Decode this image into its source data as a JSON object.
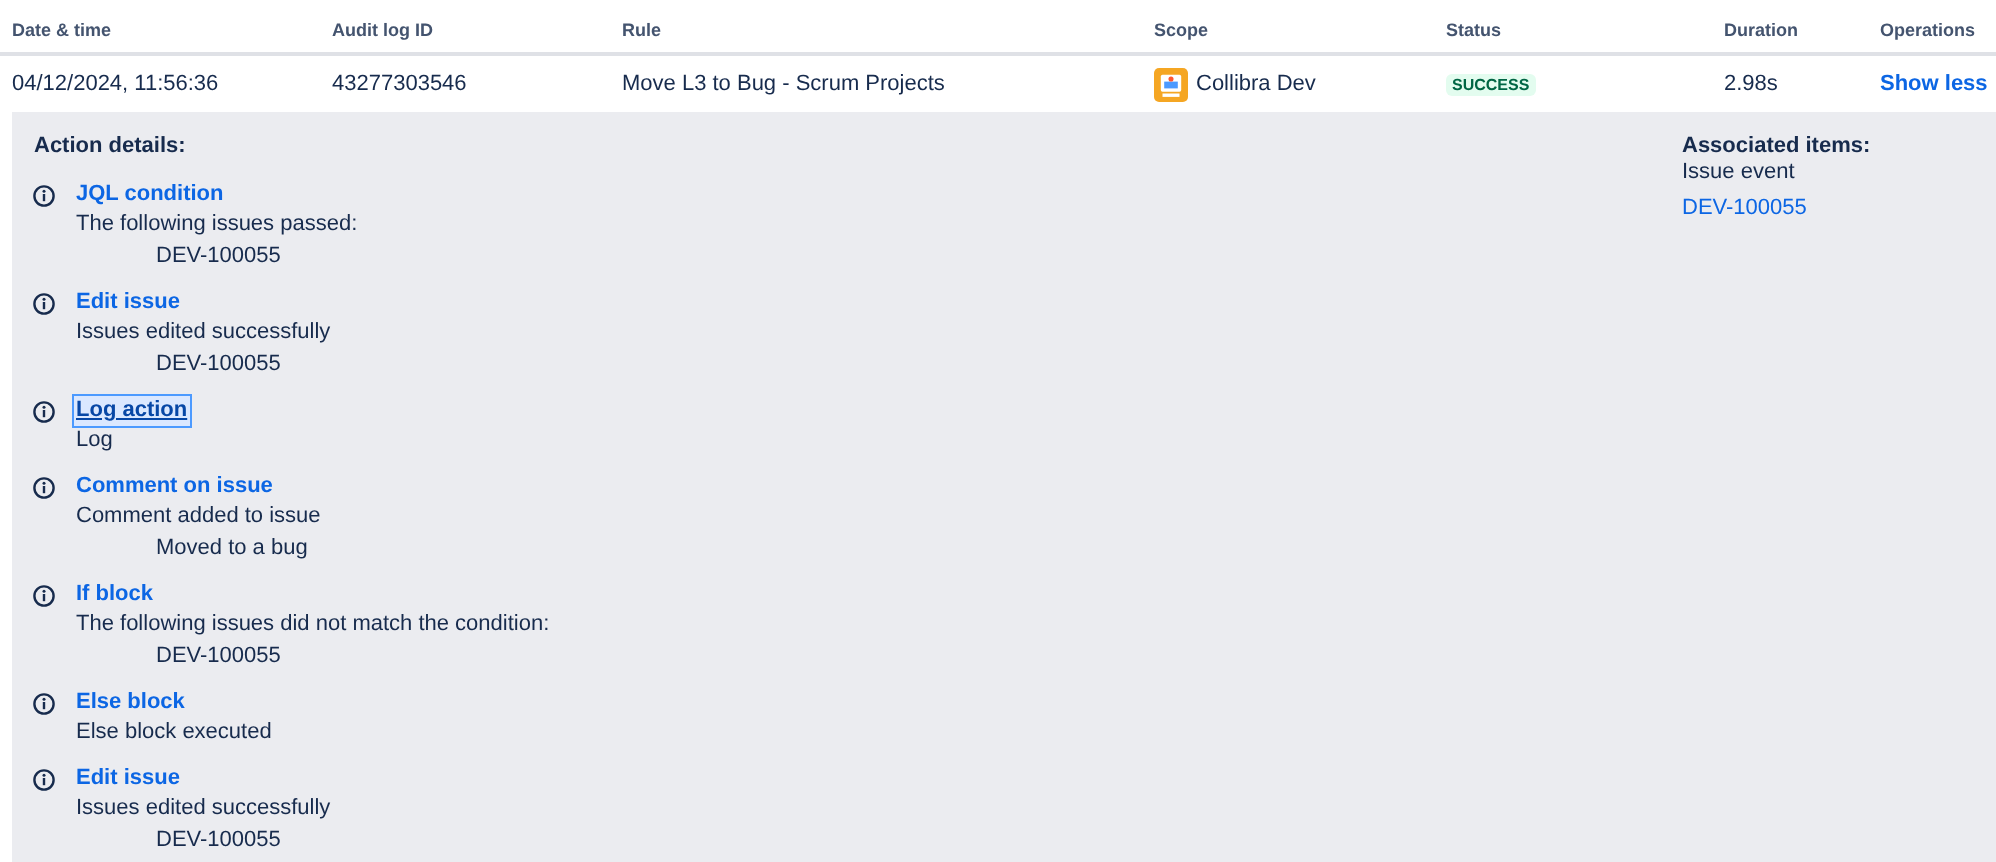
{
  "table": {
    "columns": [
      "Date & time",
      "Audit log ID",
      "Rule",
      "Scope",
      "Status",
      "Duration",
      "Operations"
    ],
    "row": {
      "date_time": "04/12/2024, 11:56:36",
      "audit_log_id": "43277303546",
      "rule": "Move L3 to Bug - Scrum Projects",
      "scope": "Collibra Dev",
      "status": "SUCCESS",
      "duration": "2.98s",
      "operation": "Show less"
    }
  },
  "details": {
    "heading": "Action details:",
    "actions": [
      {
        "title": "JQL condition",
        "focused": false,
        "text": "The following issues passed:",
        "items": [
          "DEV-100055"
        ]
      },
      {
        "title": "Edit issue",
        "focused": false,
        "text": "Issues edited successfully",
        "items": [
          "DEV-100055"
        ]
      },
      {
        "title": "Log action",
        "focused": true,
        "text": "Log"
      },
      {
        "title": "Comment on issue",
        "focused": false,
        "text": "Comment added to issue",
        "items": [
          "Moved to a bug"
        ]
      },
      {
        "title": "If block",
        "focused": false,
        "text": "The following issues did not match the condition:",
        "items": [
          "DEV-100055"
        ]
      },
      {
        "title": "Else block",
        "focused": false,
        "text": "Else block executed"
      },
      {
        "title": "Edit issue",
        "focused": false,
        "text": "Issues edited successfully",
        "items": [
          "DEV-100055"
        ]
      }
    ],
    "associated": {
      "heading": "Associated items:",
      "label": "Issue event",
      "link": "DEV-100055"
    }
  }
}
